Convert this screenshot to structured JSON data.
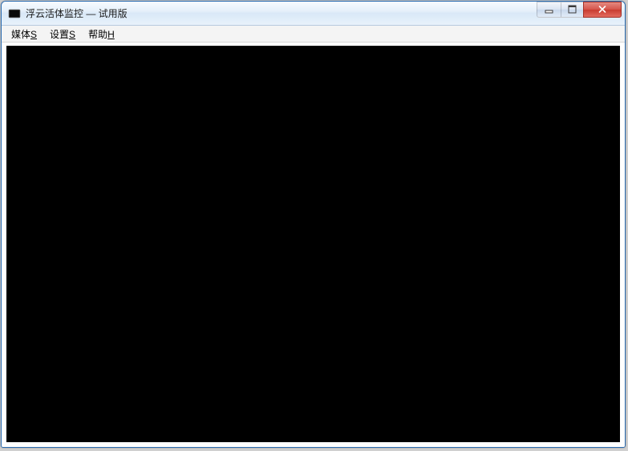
{
  "window": {
    "title": "浮云活体监控 — 试用版"
  },
  "menubar": {
    "items": [
      {
        "label": "媒体",
        "accelerator": "S"
      },
      {
        "label": "设置",
        "accelerator": "S"
      },
      {
        "label": "帮助",
        "accelerator": "H"
      }
    ]
  }
}
